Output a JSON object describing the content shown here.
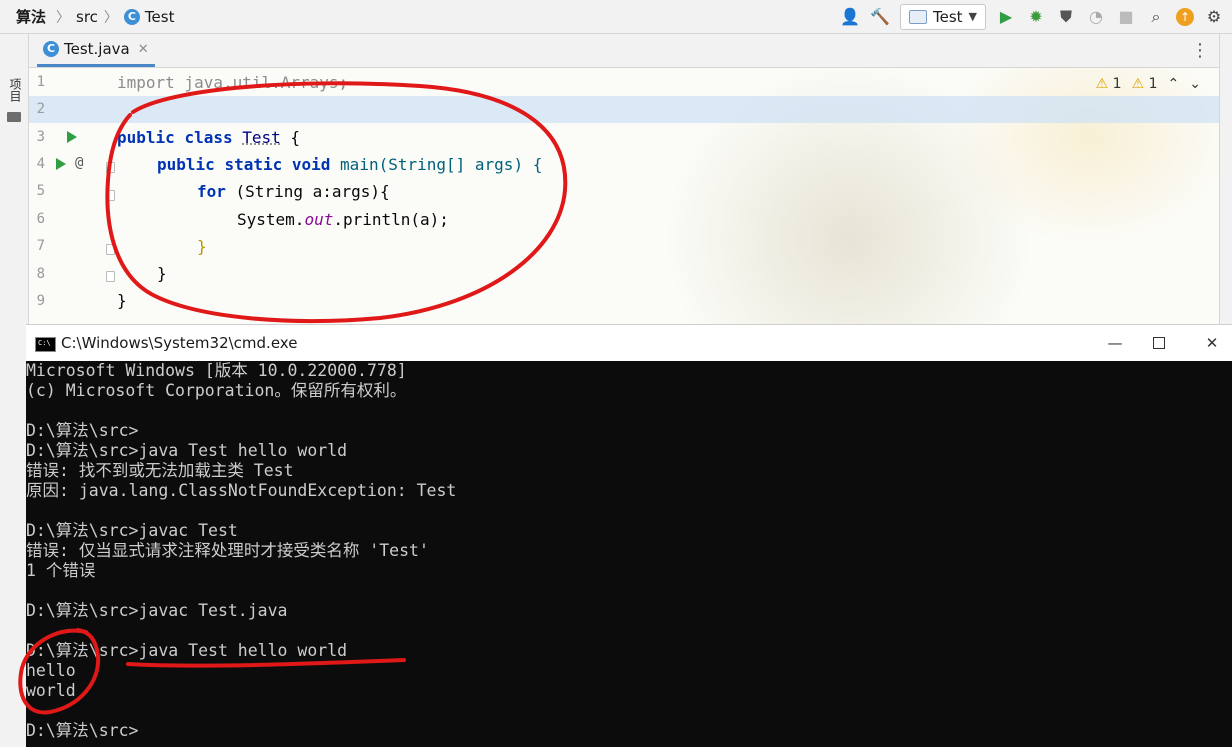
{
  "ide": {
    "project": "算法",
    "crumb_folder": "src",
    "crumb_file": "Test",
    "run_config": "Test",
    "left_panel_label": "项目",
    "tab": {
      "label": "Test.java"
    },
    "inspection": {
      "warnings": "1",
      "weak_warnings": "1"
    },
    "line_numbers": [
      "1",
      "2",
      "3",
      "4",
      "5",
      "6",
      "7",
      "8",
      "9"
    ]
  },
  "code": {
    "l1_import": "import",
    "l1_rest": " java.util.Arrays;",
    "l3_public": "public",
    "l3_class": "class",
    "l3_name": "Test",
    "l3_brace": " {",
    "l4_public": "public",
    "l4_static": "static",
    "l4_void": "void",
    "l4_rest": "main(String[] args) {",
    "l5_for": "for",
    "l5_rest": " (String a:args){",
    "l6_system": "System.",
    "l6_out": "out",
    "l6_rest": ".println(a);",
    "l7": "}",
    "l8": "}",
    "l9": "}"
  },
  "cmd": {
    "title": "C:\\Windows\\System32\\cmd.exe",
    "icon": "cmd-icon",
    "lines": [
      "Microsoft Windows [版本 10.0.22000.778]",
      "(c) Microsoft Corporation。保留所有权利。",
      "",
      "D:\\算法\\src>",
      "D:\\算法\\src>java Test hello world",
      "错误: 找不到或无法加载主类 Test",
      "原因: java.lang.ClassNotFoundException: Test",
      "",
      "D:\\算法\\src>javac Test",
      "错误: 仅当显式请求注释处理时才接受类名称 'Test'",
      "1 个错误",
      "",
      "D:\\算法\\src>javac Test.java",
      "",
      "D:\\算法\\src>java Test hello world",
      "hello",
      "world",
      "",
      "D:\\算法\\src>"
    ]
  },
  "colors": {
    "annotation": "#e01818",
    "keyword": "#0033b3",
    "run_green": "#2f9e44",
    "cmd_bg": "#0c0c0c",
    "cmd_text": "#cccccc"
  }
}
